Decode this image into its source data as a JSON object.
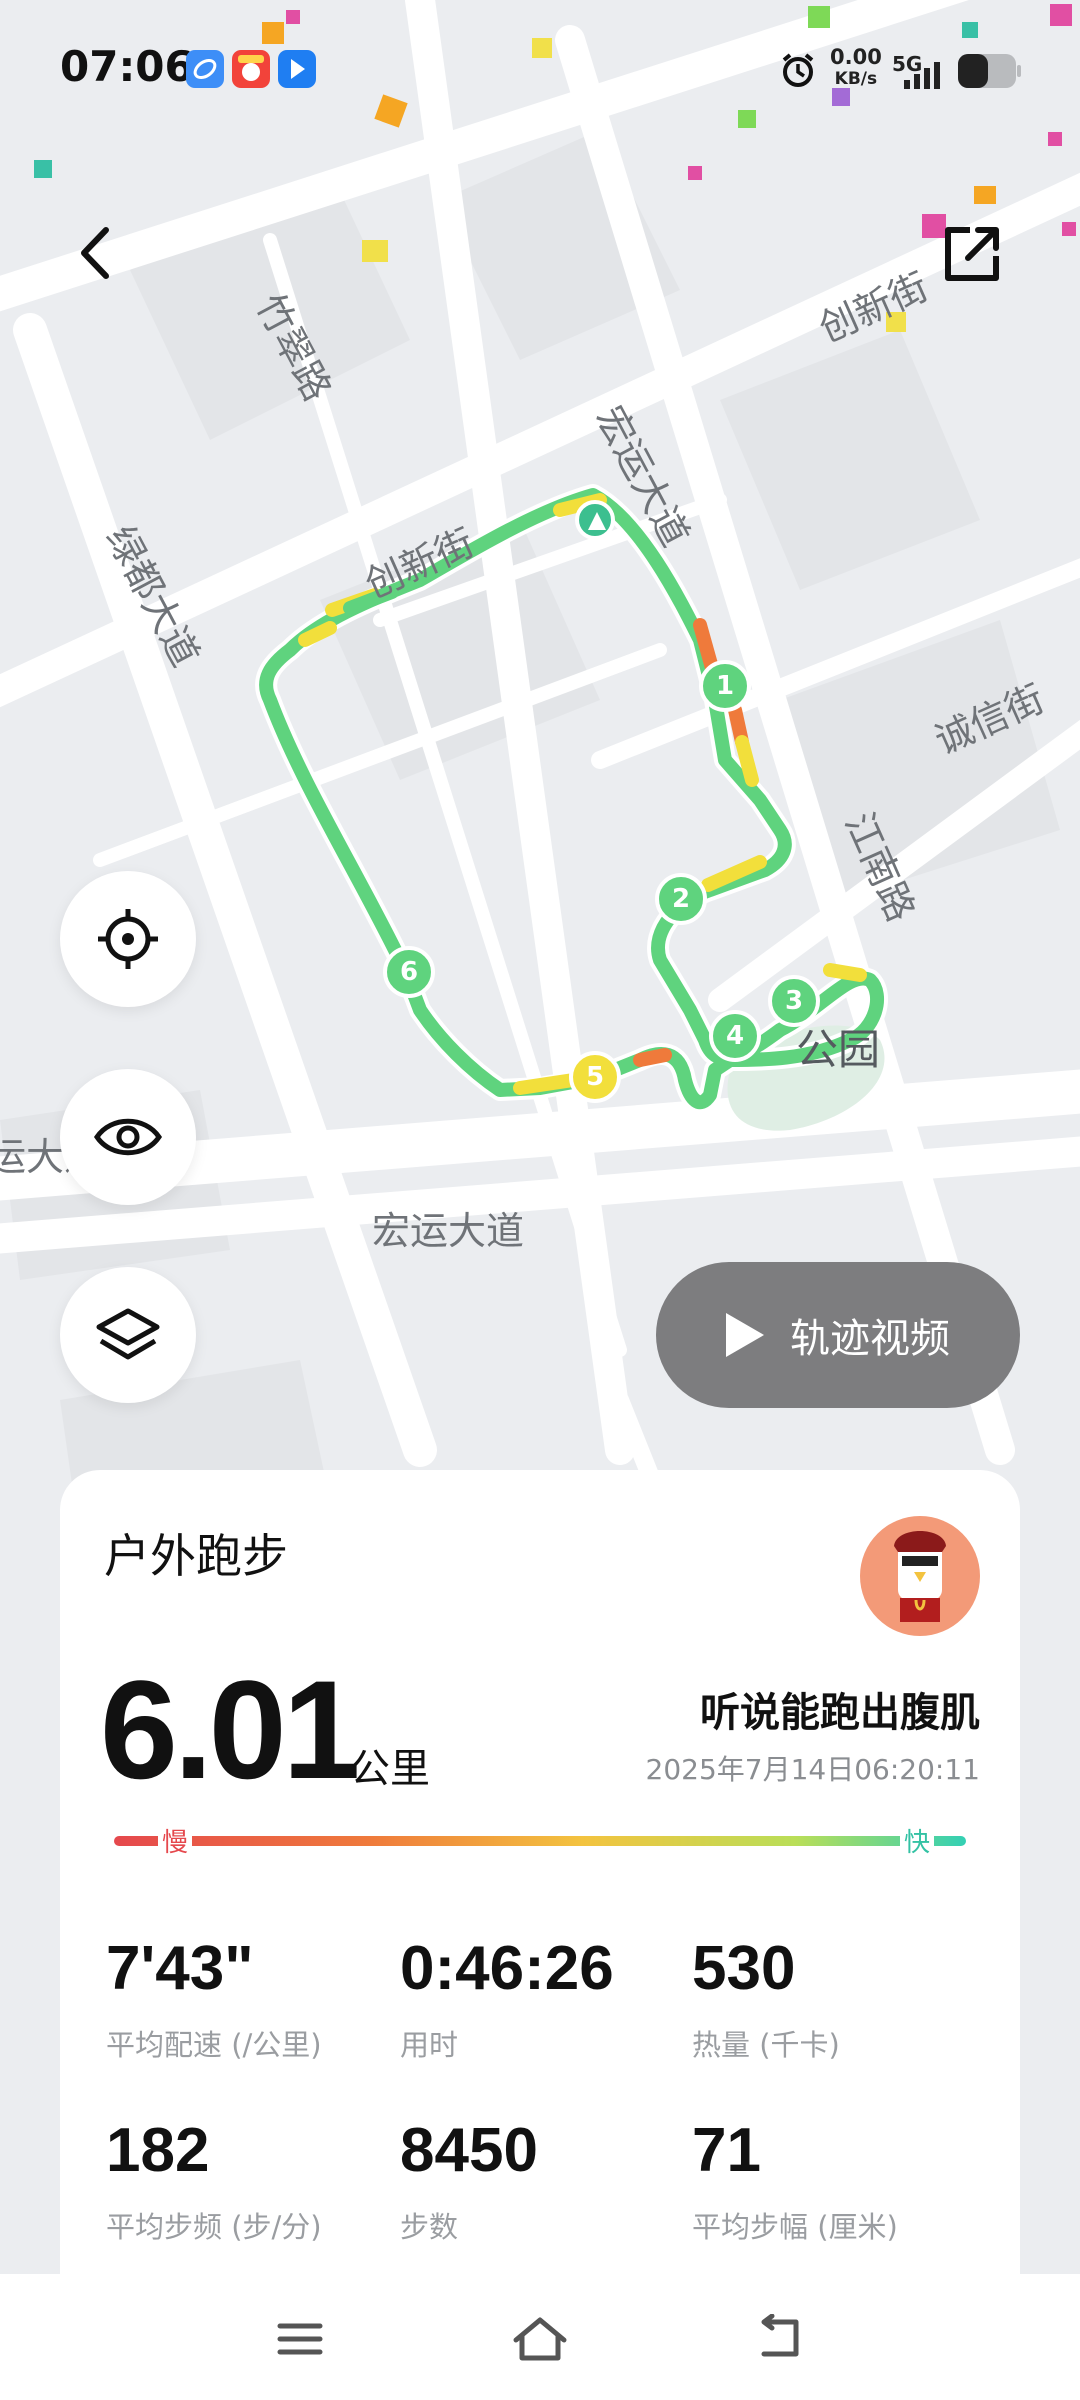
{
  "status_bar": {
    "time": "07:06",
    "net_speed_value": "0.00",
    "net_speed_unit": "KB/s",
    "network_type": "5G",
    "app_icons": [
      "browser-app-icon",
      "red-app-icon",
      "blue-app-icon"
    ]
  },
  "map": {
    "road_labels": [
      "竹翠路",
      "创新街",
      "宏运大道",
      "创新街",
      "绿都大道",
      "诚信街",
      "江南路",
      "宏运大道",
      "宏运大道"
    ],
    "park_label": "公园",
    "km_markers": [
      "1",
      "2",
      "3",
      "4",
      "5",
      "6"
    ]
  },
  "controls": {
    "video_button_label": "轨迹视频"
  },
  "summary": {
    "activity_type": "户外跑步",
    "distance": "6.01",
    "distance_unit": "公里",
    "user_name": "听说能跑出腹肌",
    "date_time": "2025年7月14日06:20:11",
    "pace_scale": {
      "slow_label": "慢",
      "fast_label": "快"
    },
    "stats": [
      {
        "value": "7'43\"",
        "label": "平均配速 (/公里)"
      },
      {
        "value": "0:46:26",
        "label": "用时"
      },
      {
        "value": "530",
        "label": "热量 (千卡)"
      },
      {
        "value": "182",
        "label": "平均步频 (步/分)"
      },
      {
        "value": "8450",
        "label": "步数"
      },
      {
        "value": "71",
        "label": "平均步幅 (厘米)"
      }
    ]
  },
  "colors": {
    "route_fast": "#5fd37e",
    "route_medium": "#f2df3b",
    "route_slow": "#ef7a3b",
    "pace_slow": "#e5484d",
    "pace_fast": "#33d0b4"
  }
}
